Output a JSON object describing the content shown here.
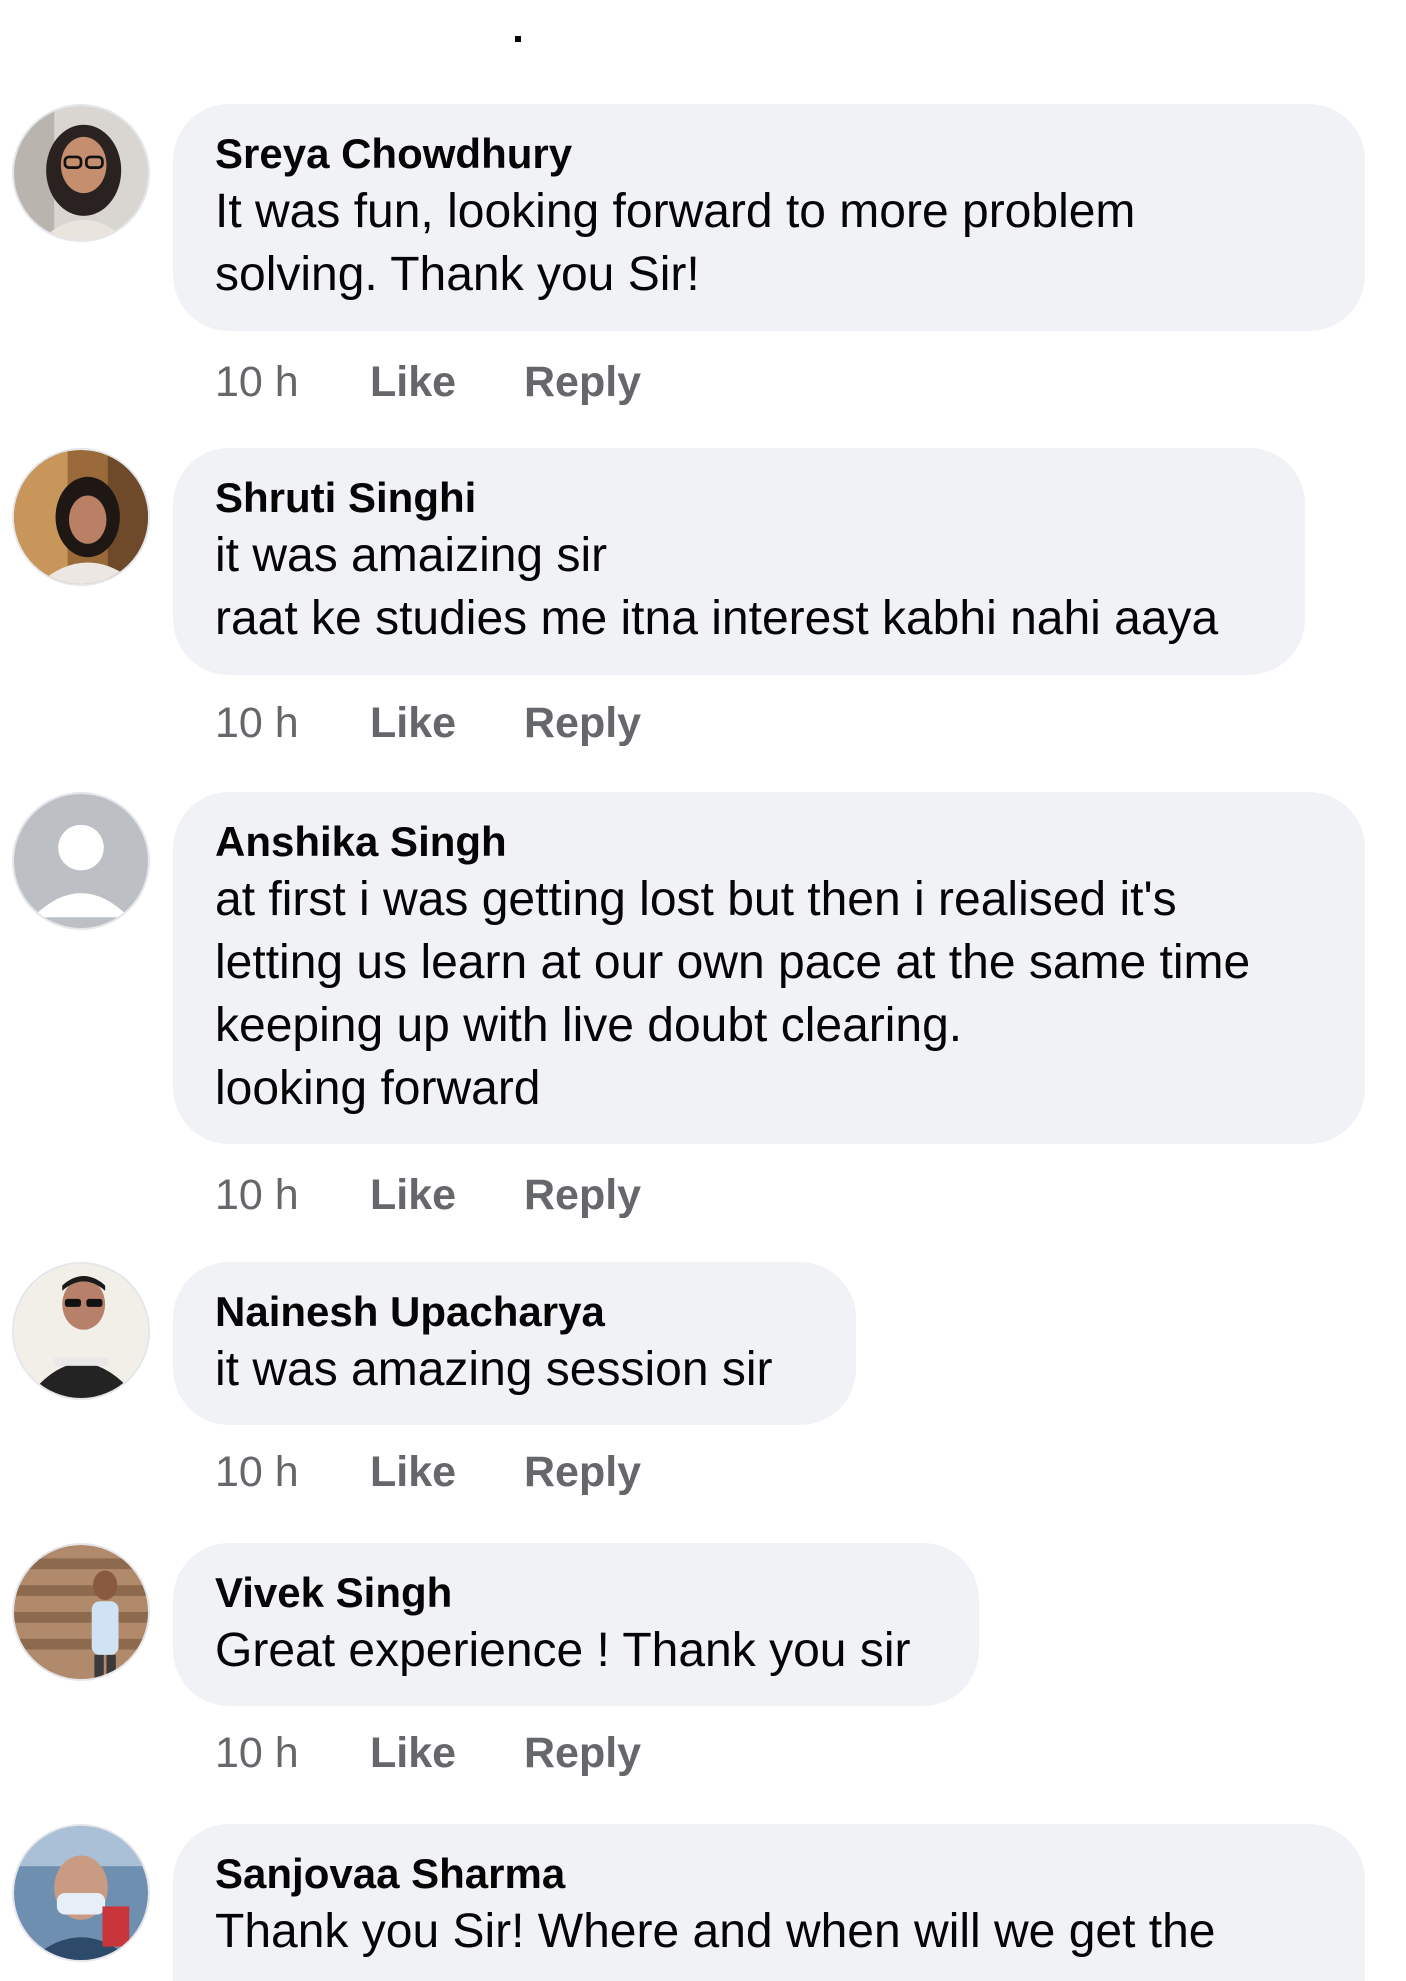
{
  "comments": [
    {
      "author": "Sreya Chowdhury",
      "lines": [
        "It was fun, looking forward to more problem",
        "solving. Thank you Sir!"
      ],
      "time": "10 h",
      "like_label": "Like",
      "reply_label": "Reply",
      "avatar_icon": "profile-photo-woman-glasses"
    },
    {
      "author": "Shruti Singhi",
      "lines": [
        "it was amaizing sir",
        "raat ke studies me itna interest kabhi nahi aaya"
      ],
      "time": "10 h",
      "like_label": "Like",
      "reply_label": "Reply",
      "avatar_icon": "profile-photo-woman"
    },
    {
      "author": "Anshika Singh",
      "lines": [
        "at first i was getting lost but then i realised it's",
        "letting us learn at our own pace at the same time",
        "keeping up with live doubt clearing.",
        "looking forward"
      ],
      "time": "10 h",
      "like_label": "Like",
      "reply_label": "Reply",
      "avatar_icon": "default-user-icon"
    },
    {
      "author": "Nainesh Upacharya",
      "lines": [
        "it was amazing session sir"
      ],
      "time": "10 h",
      "like_label": "Like",
      "reply_label": "Reply",
      "avatar_icon": "profile-photo-man-sunglasses"
    },
    {
      "author": "Vivek Singh",
      "lines": [
        "Great experience ! Thank you sir"
      ],
      "time": "10 h",
      "like_label": "Like",
      "reply_label": "Reply",
      "avatar_icon": "profile-photo-man-temple"
    },
    {
      "author": "Sanjovaa Sharma",
      "lines": [
        "Thank you Sir! Where and when will we get the"
      ],
      "avatar_icon": "profile-photo-person-mask"
    }
  ],
  "colors": {
    "bubble": "#f0f2f5",
    "meta_text": "#65676b",
    "text": "#050505"
  }
}
